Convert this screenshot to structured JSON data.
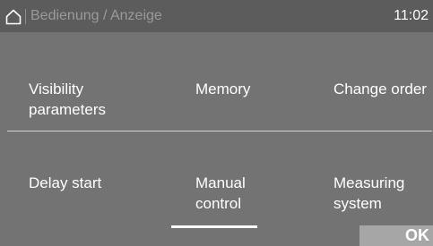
{
  "status_bar": {
    "home_icon": "home-icon",
    "breadcrumb": "Bedienung / Anzeige",
    "time": "11:02"
  },
  "menu": {
    "row1": [
      {
        "line1": "Visibility",
        "line2": "parameters"
      },
      {
        "line1": "Memory",
        "line2": ""
      },
      {
        "line1": "Change order",
        "line2": ""
      }
    ],
    "row2": [
      {
        "line1": "Delay start",
        "line2": ""
      },
      {
        "line1": "Manual",
        "line2": "control"
      },
      {
        "line1": "Measuring",
        "line2": "system"
      }
    ]
  },
  "footer": {
    "ok_label": "OK"
  },
  "colors": {
    "background": "#737373",
    "status_bar": "#5c5c5c",
    "breadcrumb_text": "#9a9a9a",
    "ok_button": "#a6a6a6",
    "text": "#ffffff"
  }
}
